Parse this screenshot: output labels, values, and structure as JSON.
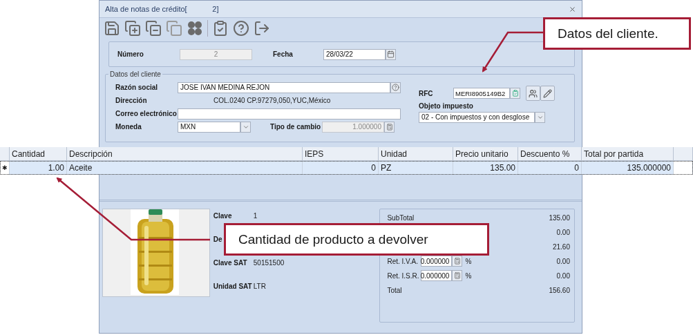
{
  "window": {
    "title": "Alta de notas de crédito[            2]"
  },
  "header": {
    "numero": {
      "label": "Número",
      "value": "2",
      "disabled": true
    },
    "fecha": {
      "label": "Fecha",
      "value": "28/03/22"
    }
  },
  "client_group": {
    "title": "Datos del cliente",
    "razon_social": {
      "label": "Razón social",
      "value": "JOSE IVAN MEDINA REJON"
    },
    "direccion": {
      "label": "Dirección",
      "value": "COL.0240 CP.97279,050,YUC,México"
    },
    "correo": {
      "label": "Correo electrónico"
    },
    "moneda": {
      "label": "Moneda",
      "value": "MXN"
    },
    "tipo_cambio": {
      "label": "Tipo de cambio",
      "value": "1.000000",
      "disabled": true
    },
    "rfc": {
      "label": "RFC",
      "value": "MERI8905149B2"
    },
    "objeto_impuesto": {
      "label": "Objeto impuesto",
      "value": "02 - Con impuestos y con desglose"
    }
  },
  "grid": {
    "columns": [
      "Cantidad",
      "Descripción",
      "IEPS",
      "Unidad",
      "Precio unitario",
      "Descuento %",
      "Total por partida"
    ],
    "rows": [
      {
        "marker": "✱",
        "selected": true,
        "cells": [
          "1.00",
          "Aceite",
          "0",
          "PZ",
          "135.00",
          "0",
          "135.000000"
        ]
      }
    ]
  },
  "product": {
    "fields": [
      {
        "label": "Clave",
        "value": "1"
      },
      {
        "label": "De"
      },
      {
        "label": "Clave SAT",
        "value": "50151500"
      },
      {
        "label": "Unidad SAT",
        "value": "LTR"
      }
    ]
  },
  "totals": [
    {
      "kind": "plain",
      "label": "SubTotal",
      "value": "135.00"
    },
    {
      "kind": "plain",
      "value": "0.00"
    },
    {
      "kind": "plain",
      "value": "21.60"
    },
    {
      "kind": "rate",
      "label": "Ret. I.V.A.",
      "rate": "0.000000",
      "unit": "%",
      "value": "0.00"
    },
    {
      "kind": "rate",
      "label": "Ret. I.S.R.",
      "rate": "0.000000",
      "unit": "%",
      "value": "0.00"
    },
    {
      "kind": "plain",
      "label": "Total",
      "value": "156.60"
    }
  ],
  "callouts": [
    {
      "text": "Datos del cliente."
    },
    {
      "text": "Cantidad de producto a devolver"
    }
  ]
}
